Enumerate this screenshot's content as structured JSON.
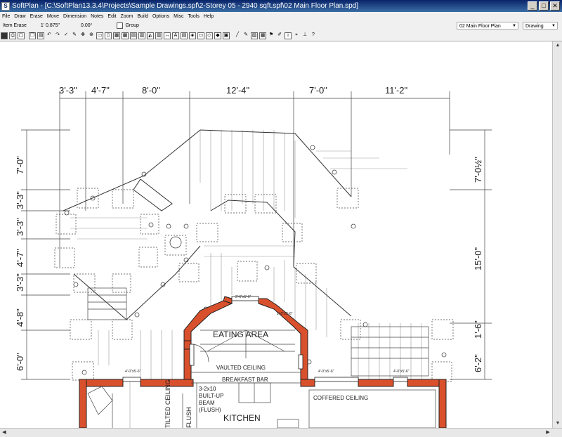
{
  "window": {
    "title": "SoftPlan - [C:\\SoftPlan13.3.4\\Projects\\Sample Drawings.spf\\2-Storey 05 - 2940 sqft.spf\\02 Main Floor Plan.spd]",
    "app_icon": "S",
    "minimize": "_",
    "maximize": "□",
    "close": "✕"
  },
  "menu": [
    "File",
    "Draw",
    "Erase",
    "Move",
    "Dimension",
    "Notes",
    "Edit",
    "Zoom",
    "Build",
    "Options",
    "Misc",
    "Tools",
    "Help"
  ],
  "props": {
    "mode": "Item Erase",
    "value1": "1' 0.875\"",
    "value2": "0.00°",
    "group_label": "Group",
    "level": "02 Main Floor Plan",
    "view": "Drawing"
  },
  "dims_top": [
    "3'-3\"",
    "4'-7\"",
    "8'-0\"",
    "12'-4\"",
    "7'-0\"",
    "11'-2\""
  ],
  "dims_left": [
    "7'-0\"",
    "3'-3\"",
    "3'-3\"",
    "4'-7\"",
    "3'-3\"",
    "4'-8\"",
    "6'-0\""
  ],
  "dims_right": [
    "7'-0½\"",
    "15'-0\"",
    "1'-6\"",
    "6'-2\""
  ],
  "labels": {
    "eating": "EATING AREA",
    "vaulted": "VAULTED CEILING",
    "breakfast": "BREAKFAST BAR",
    "beam1": "3-2x10",
    "beam2": "BUILT-UP",
    "beam3": "BEAM",
    "beam4": "(FLUSH)",
    "kitchen": "KITCHEN",
    "coffered": "COFFERED CEILING",
    "tilted": "TILTED CEILING",
    "flush": "FLUSH",
    "win1": "4'-0\"x5'-6\"",
    "win2": "4'-0\"x5'-6\"",
    "win3": "4'-0\"x5'-6\"",
    "win4": "2'-6\"x5'-6\"",
    "win5": "2'-6\"x5'-6\""
  },
  "colors": {
    "wall": "#d9502c",
    "title_bar": "#0a246a"
  }
}
